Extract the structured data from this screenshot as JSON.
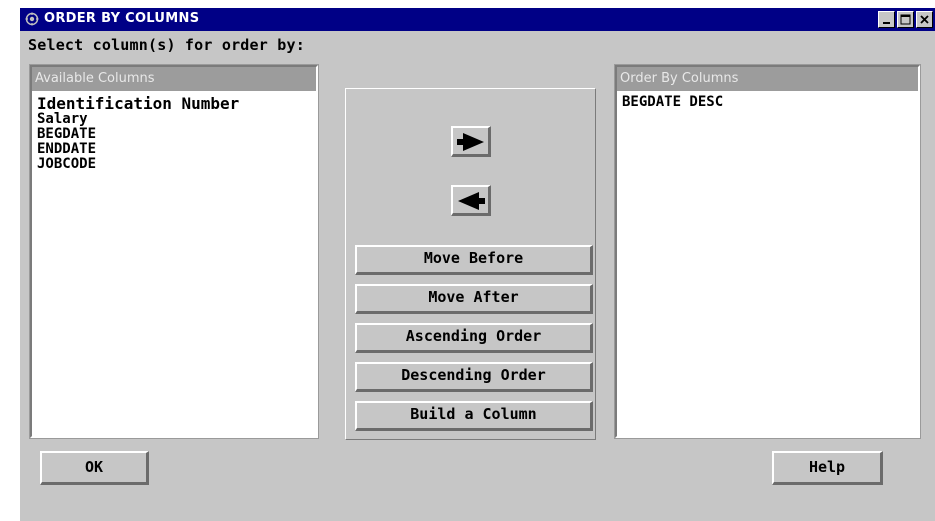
{
  "window": {
    "title": "ORDER BY COLUMNS",
    "title_bar_color": "#000086",
    "controls": [
      "minimize-icon",
      "maximize-icon",
      "close-icon"
    ]
  },
  "prompt": "Select column(s) for order by:",
  "available_columns": {
    "header": "Available Columns",
    "items": [
      "Identification Number",
      "Salary",
      "BEGDATE",
      "ENDDATE",
      "JOBCODE"
    ]
  },
  "order_by_columns": {
    "header": "Order By Columns",
    "items": [
      "BEGDATE DESC"
    ]
  },
  "buttons": {
    "add": "right-arrow-icon",
    "remove": "left-arrow-icon",
    "move_before": "Move Before",
    "move_after": "Move After",
    "ascending": "Ascending Order",
    "descending": "Descending Order",
    "build_column": "Build a Column",
    "ok": "OK",
    "help": "Help"
  }
}
